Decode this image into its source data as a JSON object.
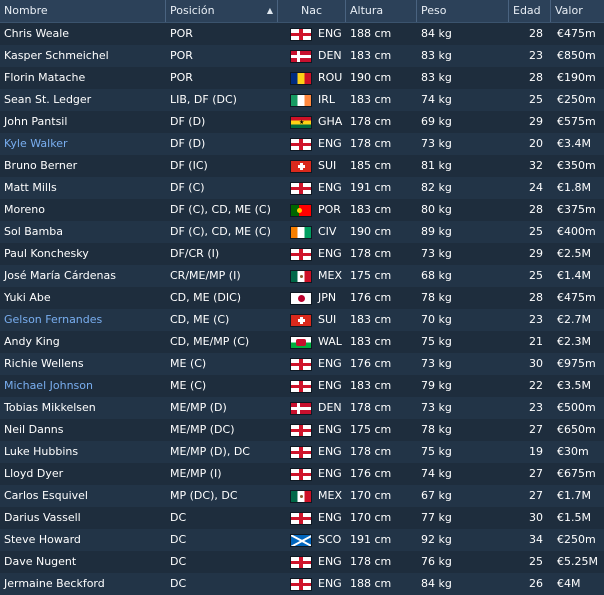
{
  "header": {
    "columns": [
      "Nombre",
      "Posición",
      "Nac",
      "Altura",
      "Peso",
      "Edad",
      "Valor"
    ],
    "sorted_column": "Posición",
    "sort_direction": "ascending",
    "sort_icon": "sort-up-arrow-icon"
  },
  "colors": {
    "background": "#1e2d3d",
    "header": "#2c4159",
    "highlight_text": "#79aef0"
  },
  "players": [
    {
      "name": "Chris Weale",
      "pos": "POR",
      "nat": "ENG",
      "flag": "eng",
      "height": "188 cm",
      "weight": "84 kg",
      "age": "28",
      "value": "€475m",
      "highlight": false
    },
    {
      "name": "Kasper Schmeichel",
      "pos": "POR",
      "nat": "DEN",
      "flag": "den",
      "height": "183 cm",
      "weight": "83 kg",
      "age": "23",
      "value": "€850m",
      "highlight": false
    },
    {
      "name": "Florin Matache",
      "pos": "POR",
      "nat": "ROU",
      "flag": "rou",
      "height": "190 cm",
      "weight": "83 kg",
      "age": "28",
      "value": "€190m",
      "highlight": false
    },
    {
      "name": "Sean St. Ledger",
      "pos": "LIB, DF (DC)",
      "nat": "IRL",
      "flag": "irl",
      "height": "183 cm",
      "weight": "74 kg",
      "age": "25",
      "value": "€250m",
      "highlight": false
    },
    {
      "name": "John Pantsil",
      "pos": "DF (D)",
      "nat": "GHA",
      "flag": "gha",
      "height": "178 cm",
      "weight": "69 kg",
      "age": "29",
      "value": "€575m",
      "highlight": false
    },
    {
      "name": "Kyle Walker",
      "pos": "DF (D)",
      "nat": "ENG",
      "flag": "eng",
      "height": "178 cm",
      "weight": "73 kg",
      "age": "20",
      "value": "€3.4M",
      "highlight": true
    },
    {
      "name": "Bruno Berner",
      "pos": "DF (IC)",
      "nat": "SUI",
      "flag": "sui",
      "height": "185 cm",
      "weight": "81 kg",
      "age": "32",
      "value": "€350m",
      "highlight": false
    },
    {
      "name": "Matt Mills",
      "pos": "DF (C)",
      "nat": "ENG",
      "flag": "eng",
      "height": "191 cm",
      "weight": "82 kg",
      "age": "24",
      "value": "€1.8M",
      "highlight": false
    },
    {
      "name": "Moreno",
      "pos": "DF (C), CD, ME (C)",
      "nat": "POR",
      "flag": "por",
      "height": "183 cm",
      "weight": "80 kg",
      "age": "28",
      "value": "€375m",
      "highlight": false
    },
    {
      "name": "Sol Bamba",
      "pos": "DF (C), CD, ME (C)",
      "nat": "CIV",
      "flag": "civ",
      "height": "190 cm",
      "weight": "89 kg",
      "age": "25",
      "value": "€400m",
      "highlight": false
    },
    {
      "name": "Paul Konchesky",
      "pos": "DF/CR (I)",
      "nat": "ENG",
      "flag": "eng",
      "height": "178 cm",
      "weight": "73 kg",
      "age": "29",
      "value": "€2.5M",
      "highlight": false
    },
    {
      "name": "José María Cárdenas",
      "pos": "CR/ME/MP (I)",
      "nat": "MEX",
      "flag": "mex",
      "height": "175 cm",
      "weight": "68 kg",
      "age": "25",
      "value": "€1.4M",
      "highlight": false
    },
    {
      "name": "Yuki Abe",
      "pos": "CD, ME (DIC)",
      "nat": "JPN",
      "flag": "jpn",
      "height": "176 cm",
      "weight": "78 kg",
      "age": "28",
      "value": "€475m",
      "highlight": false
    },
    {
      "name": "Gelson Fernandes",
      "pos": "CD, ME (C)",
      "nat": "SUI",
      "flag": "sui",
      "height": "183 cm",
      "weight": "70 kg",
      "age": "23",
      "value": "€2.7M",
      "highlight": true
    },
    {
      "name": "Andy King",
      "pos": "CD, ME/MP (C)",
      "nat": "WAL",
      "flag": "wal",
      "height": "183 cm",
      "weight": "75 kg",
      "age": "21",
      "value": "€2.3M",
      "highlight": false
    },
    {
      "name": "Richie Wellens",
      "pos": "ME (C)",
      "nat": "ENG",
      "flag": "eng",
      "height": "176 cm",
      "weight": "73 kg",
      "age": "30",
      "value": "€975m",
      "highlight": false
    },
    {
      "name": "Michael Johnson",
      "pos": "ME (C)",
      "nat": "ENG",
      "flag": "eng",
      "height": "183 cm",
      "weight": "79 kg",
      "age": "22",
      "value": "€3.5M",
      "highlight": true
    },
    {
      "name": "Tobias Mikkelsen",
      "pos": "ME/MP (D)",
      "nat": "DEN",
      "flag": "den",
      "height": "178 cm",
      "weight": "73 kg",
      "age": "23",
      "value": "€500m",
      "highlight": false
    },
    {
      "name": "Neil Danns",
      "pos": "ME/MP (DC)",
      "nat": "ENG",
      "flag": "eng",
      "height": "175 cm",
      "weight": "78 kg",
      "age": "27",
      "value": "€650m",
      "highlight": false
    },
    {
      "name": "Luke Hubbins",
      "pos": "ME/MP (D), DC",
      "nat": "ENG",
      "flag": "eng",
      "height": "178 cm",
      "weight": "75 kg",
      "age": "19",
      "value": "€30m",
      "highlight": false
    },
    {
      "name": "Lloyd Dyer",
      "pos": "ME/MP (I)",
      "nat": "ENG",
      "flag": "eng",
      "height": "176 cm",
      "weight": "74 kg",
      "age": "27",
      "value": "€675m",
      "highlight": false
    },
    {
      "name": "Carlos Esquivel",
      "pos": "MP (DC), DC",
      "nat": "MEX",
      "flag": "mex",
      "height": "170 cm",
      "weight": "67 kg",
      "age": "27",
      "value": "€1.7M",
      "highlight": false
    },
    {
      "name": "Darius Vassell",
      "pos": "DC",
      "nat": "ENG",
      "flag": "eng",
      "height": "170 cm",
      "weight": "77 kg",
      "age": "30",
      "value": "€1.5M",
      "highlight": false
    },
    {
      "name": "Steve Howard",
      "pos": "DC",
      "nat": "SCO",
      "flag": "sco",
      "height": "191 cm",
      "weight": "92 kg",
      "age": "34",
      "value": "€250m",
      "highlight": false
    },
    {
      "name": "Dave Nugent",
      "pos": "DC",
      "nat": "ENG",
      "flag": "eng",
      "height": "178 cm",
      "weight": "76 kg",
      "age": "25",
      "value": "€5.25M",
      "highlight": false
    },
    {
      "name": "Jermaine Beckford",
      "pos": "DC",
      "nat": "ENG",
      "flag": "eng",
      "height": "188 cm",
      "weight": "84 kg",
      "age": "26",
      "value": "€4M",
      "highlight": false
    }
  ]
}
